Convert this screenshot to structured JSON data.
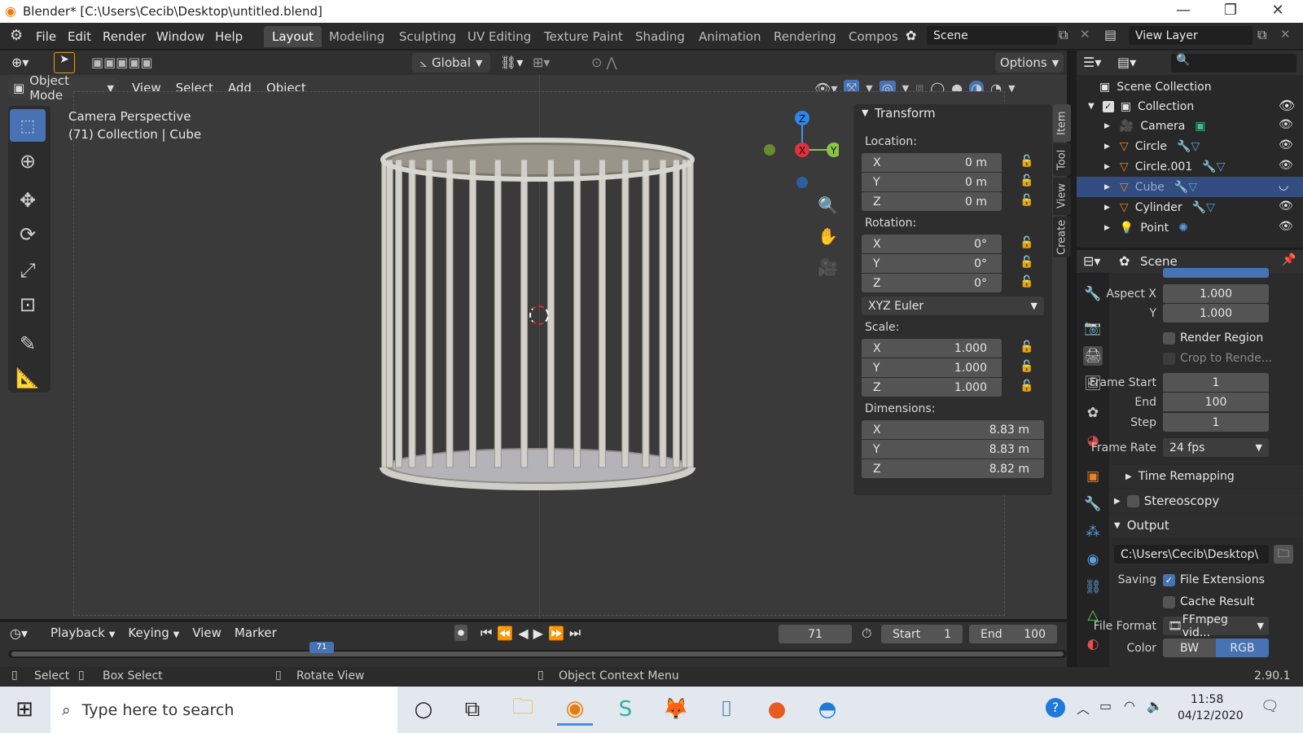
{
  "window": {
    "title": "Blender* [C:\\Users\\Cecib\\Desktop\\untitled.blend]",
    "minimize": "—",
    "maximize": "❐",
    "close": "✕"
  },
  "menu": [
    "File",
    "Edit",
    "Render",
    "Window",
    "Help"
  ],
  "workspaces": [
    "Layout",
    "Modeling",
    "Sculpting",
    "UV Editing",
    "Texture Paint",
    "Shading",
    "Animation",
    "Rendering",
    "Compos"
  ],
  "scene": {
    "name": "Scene"
  },
  "view_layer": {
    "name": "View Layer"
  },
  "toolheader": {
    "orientation": "Global",
    "options": "Options"
  },
  "viewport_header": {
    "mode": "Object Mode",
    "menus": [
      "View",
      "Select",
      "Add",
      "Object"
    ]
  },
  "viewport": {
    "camera_label": "Camera Perspective",
    "collection_label": "(71) Collection | Cube",
    "gizmo": {
      "z": "Z",
      "x": "X",
      "y": "Y"
    }
  },
  "side_tabs": [
    "Item",
    "Tool",
    "View",
    "Create"
  ],
  "transform": {
    "title": "Transform",
    "location_label": "Location:",
    "location": [
      {
        "axis": "X",
        "value": "0 m"
      },
      {
        "axis": "Y",
        "value": "0 m"
      },
      {
        "axis": "Z",
        "value": "0 m"
      }
    ],
    "rotation_label": "Rotation:",
    "rotation": [
      {
        "axis": "X",
        "value": "0°"
      },
      {
        "axis": "Y",
        "value": "0°"
      },
      {
        "axis": "Z",
        "value": "0°"
      }
    ],
    "rotation_mode": "XYZ Euler",
    "scale_label": "Scale:",
    "scale": [
      {
        "axis": "X",
        "value": "1.000"
      },
      {
        "axis": "Y",
        "value": "1.000"
      },
      {
        "axis": "Z",
        "value": "1.000"
      }
    ],
    "dimensions_label": "Dimensions:",
    "dimensions": [
      {
        "axis": "X",
        "value": "8.83 m"
      },
      {
        "axis": "Y",
        "value": "8.83 m"
      },
      {
        "axis": "Z",
        "value": "8.82 m"
      }
    ]
  },
  "outliner": {
    "scene_collection": "Scene Collection",
    "collection": "Collection",
    "items": [
      {
        "name": "Camera",
        "icon": "camera-icon",
        "selected": false
      },
      {
        "name": "Circle",
        "icon": "mesh-icon",
        "selected": false
      },
      {
        "name": "Circle.001",
        "icon": "mesh-icon",
        "selected": false
      },
      {
        "name": "Cube",
        "icon": "mesh-icon",
        "selected": true
      },
      {
        "name": "Cylinder",
        "icon": "mesh-icon",
        "selected": false
      },
      {
        "name": "Point",
        "icon": "light-icon",
        "selected": false
      }
    ]
  },
  "properties": {
    "header": "Scene",
    "aspect_x_label": "Aspect X",
    "aspect_x": "1.000",
    "aspect_y_label": "Y",
    "aspect_y": "1.000",
    "render_region": "Render Region",
    "crop": "Crop to Rende...",
    "frame_start_label": "Frame Start",
    "frame_start": "1",
    "end_label": "End",
    "end": "100",
    "step_label": "Step",
    "step": "1",
    "frame_rate_label": "Frame Rate",
    "frame_rate": "24 fps",
    "time_remapping": "Time Remapping",
    "stereoscopy": "Stereoscopy",
    "output": "Output",
    "output_path": "C:\\Users\\Cecib\\Desktop\\",
    "saving_label": "Saving",
    "file_extensions": "File Extensions",
    "cache_result": "Cache Result",
    "file_format_label": "File Format",
    "file_format": "FFmpeg vid...",
    "color_label": "Color",
    "color_bw": "BW",
    "color_rgb": "RGB"
  },
  "timeline": {
    "menus": [
      "Playback",
      "Keying",
      "View",
      "Marker"
    ],
    "current_frame": "71",
    "start_label": "Start",
    "start": "1",
    "end_label": "End",
    "end": "100",
    "playhead": "71"
  },
  "statusbar": {
    "select": "Select",
    "box_select": "Box Select",
    "rotate_view": "Rotate View",
    "context_menu": "Object Context Menu",
    "version": "2.90.1"
  },
  "taskbar": {
    "search_placeholder": "Type here to search",
    "time": "11:58",
    "date": "04/12/2020"
  },
  "colors": {
    "accent": "#4772b3",
    "selected_row": "#334d80",
    "header": "#303030",
    "viewport": "#393939"
  }
}
